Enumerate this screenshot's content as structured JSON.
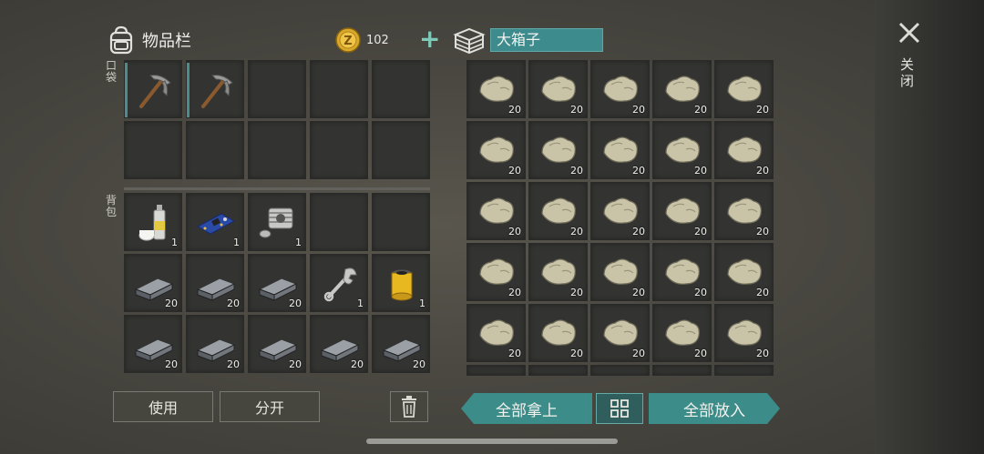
{
  "inventory": {
    "title": "物品栏",
    "coins": "102",
    "pocket_label": "口袋",
    "backpack_label": "背包",
    "pocket_slots": [
      {
        "item": "pickaxe-icon",
        "qty": "",
        "active": true
      },
      {
        "item": "pickaxe-icon",
        "qty": "",
        "active": true
      },
      {
        "item": "",
        "qty": ""
      },
      {
        "item": "",
        "qty": ""
      },
      {
        "item": "",
        "qty": ""
      },
      {
        "item": "",
        "qty": ""
      },
      {
        "item": "",
        "qty": ""
      },
      {
        "item": "",
        "qty": ""
      },
      {
        "item": "",
        "qty": ""
      },
      {
        "item": "",
        "qty": ""
      }
    ],
    "backpack_slots": [
      {
        "item": "spray-can-icon",
        "qty": "1"
      },
      {
        "item": "circuit-board-icon",
        "qty": "1"
      },
      {
        "item": "engine-cylinder-icon",
        "qty": "1"
      },
      {
        "item": "",
        "qty": ""
      },
      {
        "item": "",
        "qty": ""
      },
      {
        "item": "iron-ingot-icon",
        "qty": "20"
      },
      {
        "item": "iron-ingot-icon",
        "qty": "20"
      },
      {
        "item": "iron-ingot-icon",
        "qty": "20"
      },
      {
        "item": "wrench-icon",
        "qty": "1"
      },
      {
        "item": "oil-filter-icon",
        "qty": "1"
      },
      {
        "item": "iron-ingot-icon",
        "qty": "20"
      },
      {
        "item": "iron-ingot-icon",
        "qty": "20"
      },
      {
        "item": "iron-ingot-icon",
        "qty": "20"
      },
      {
        "item": "iron-ingot-icon",
        "qty": "20"
      },
      {
        "item": "iron-ingot-icon",
        "qty": "20"
      }
    ],
    "use_label": "使用",
    "split_label": "分开"
  },
  "container": {
    "name": "大箱子",
    "stone_qty": "20",
    "take_all_label": "全部拿上",
    "put_all_label": "全部放入"
  },
  "close_label": "关闭",
  "colors": {
    "accent": "#3c8c8a",
    "slot_bg": "#333431",
    "coin": "#d9a92a"
  }
}
